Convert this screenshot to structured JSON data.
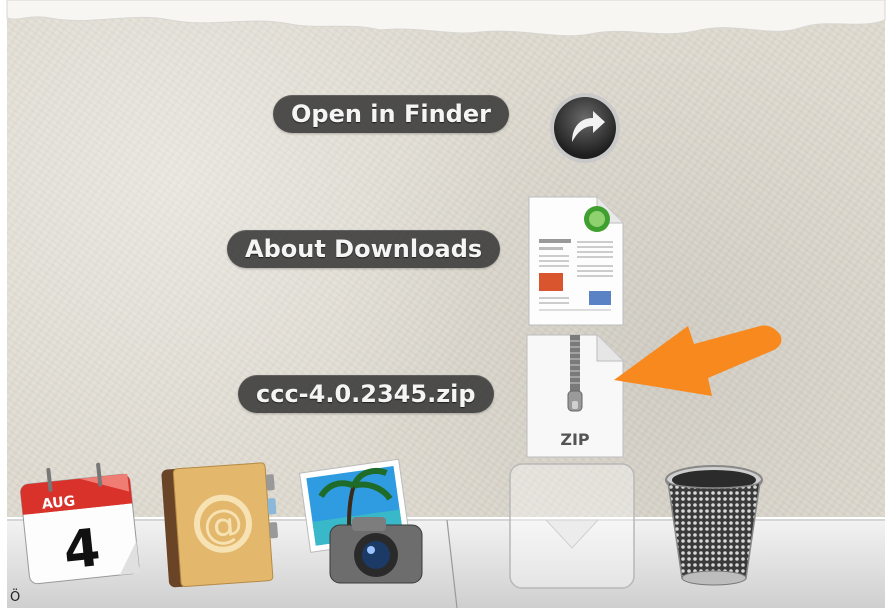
{
  "stack_menu": {
    "items": [
      {
        "label": "Open in Finder",
        "icon": "arrow-circle-icon"
      },
      {
        "label": "About Downloads",
        "icon": "document-preview-icon"
      },
      {
        "label": "ccc-4.0.2345.zip",
        "icon": "zip-archive-icon",
        "file_type": "ZIP"
      }
    ]
  },
  "dock": {
    "apps": [
      {
        "name": "Calendar",
        "icon": "calendar-icon",
        "month": "AUG",
        "day": "4"
      },
      {
        "name": "Contacts",
        "icon": "address-book-icon"
      },
      {
        "name": "iPhoto",
        "icon": "iphoto-icon"
      },
      {
        "name": "Downloads",
        "icon": "downloads-stack-icon"
      },
      {
        "name": "Trash",
        "icon": "trash-icon"
      }
    ]
  },
  "bottom_text": "Ö",
  "colors": {
    "pill_bg": "#343434",
    "arrow": "#f7891f",
    "calendar_red": "#d9322b"
  }
}
